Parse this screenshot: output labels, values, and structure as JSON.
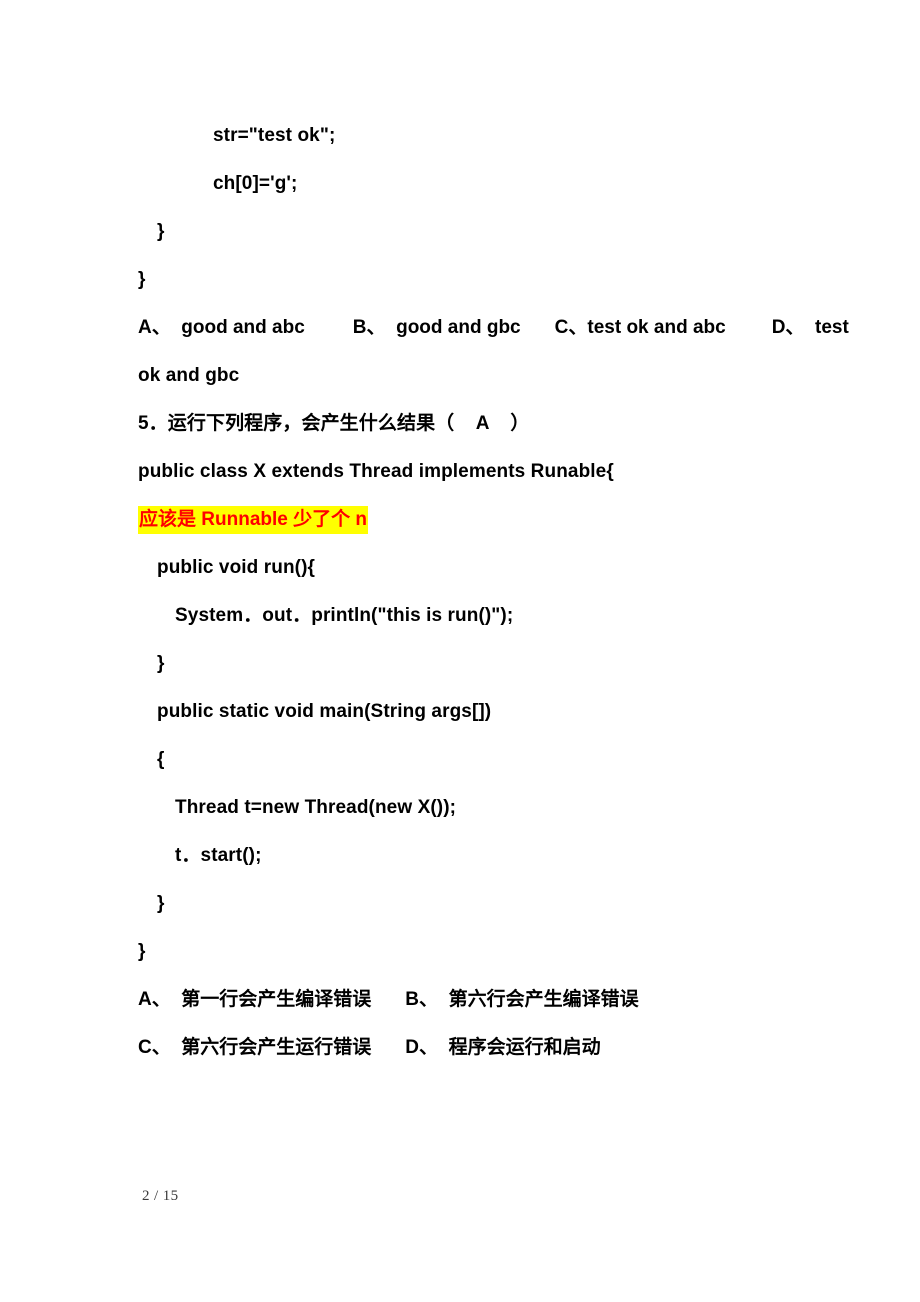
{
  "document": {
    "page_footer": "2 / 15"
  },
  "question4_tail": {
    "code_lines": [
      {
        "text": "str=\"test ok\";",
        "indent": 4
      },
      {
        "text": "ch[0]='g';",
        "indent": 4
      },
      {
        "text": "}",
        "indent": 1
      },
      {
        "text": "}",
        "indent": 0
      }
    ],
    "options_line1": [
      {
        "label": "A、",
        "text": "  good and abc"
      },
      {
        "label": "B、",
        "text": "  good and gbc"
      },
      {
        "label": "C、",
        "text": "test ok and abc"
      },
      {
        "label": "D、",
        "text": "  test"
      }
    ],
    "options_wrap": "ok and gbc"
  },
  "question5": {
    "number": "5",
    "stem": "5．运行下列程序，会产生什么结果（    A    ）",
    "class_declaration": "public class X extends Thread implements Runable{",
    "annotation": "应该是 Runnable 少了个 n",
    "annotation_text_color": "#FF0000",
    "annotation_highlight_color": "#FFFF00",
    "code_lines": [
      {
        "text": "public void run(){",
        "indent": 1
      },
      {
        "text": "System．out．println(\"this is run()\");",
        "indent": 2
      },
      {
        "text": "}",
        "indent": 1
      },
      {
        "text": "public static void main(String args[])",
        "indent": 1
      },
      {
        "text": "{",
        "indent": 1
      },
      {
        "text": "Thread t=new Thread(new X());",
        "indent": 2
      },
      {
        "text": "t．start();",
        "indent": 2
      },
      {
        "text": "}",
        "indent": 1
      },
      {
        "text": "}",
        "indent": 0
      }
    ],
    "options_row1": [
      {
        "label": "A、",
        "text": "  第一行会产生编译错误"
      },
      {
        "label": "B、",
        "text": "  第六行会产生编译错误"
      }
    ],
    "options_row2": [
      {
        "label": "C、",
        "text": "  第六行会产生运行错误"
      },
      {
        "label": "D、",
        "text": "  程序会运行和启动"
      }
    ]
  }
}
